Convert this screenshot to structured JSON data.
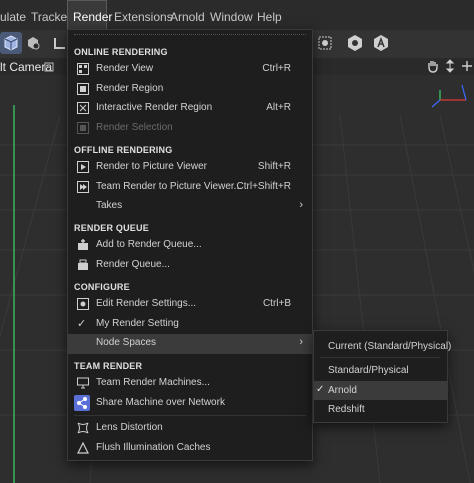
{
  "menubar": {
    "items": [
      "ulate",
      "Tracker",
      "Render",
      "Extensions",
      "Arnold",
      "Window",
      "Help"
    ]
  },
  "viewport": {
    "camera_label": "lt Camera"
  },
  "menu": {
    "sections": {
      "online": "ONLINE RENDERING",
      "offline": "OFFLINE RENDERING",
      "queue": "RENDER QUEUE",
      "configure": "CONFIGURE",
      "team": "TEAM RENDER"
    },
    "items": {
      "render_view": {
        "label": "Render View",
        "shortcut": "Ctrl+R"
      },
      "render_region": {
        "label": "Render Region"
      },
      "interactive_render_region": {
        "label": "Interactive Render Region",
        "shortcut": "Alt+R"
      },
      "render_selection": {
        "label": "Render Selection"
      },
      "render_to_picture_viewer": {
        "label": "Render to Picture Viewer",
        "shortcut": "Shift+R"
      },
      "team_render_to_picture_viewer": {
        "label": "Team Render to Picture Viewer...",
        "shortcut": "Ctrl+Shift+R"
      },
      "takes": {
        "label": "Takes"
      },
      "add_to_render_queue": {
        "label": "Add to Render Queue..."
      },
      "render_queue": {
        "label": "Render Queue..."
      },
      "edit_render_settings": {
        "label": "Edit Render Settings...",
        "shortcut": "Ctrl+B"
      },
      "my_render_setting": {
        "label": "My Render Setting"
      },
      "node_spaces": {
        "label": "Node Spaces"
      },
      "team_render_machines": {
        "label": "Team Render Machines..."
      },
      "share_machine": {
        "label": "Share Machine over Network"
      },
      "lens_distortion": {
        "label": "Lens Distortion"
      },
      "flush_illumination": {
        "label": "Flush Illumination Caches"
      }
    }
  },
  "submenu": {
    "items": [
      {
        "label": "Current (Standard/Physical)"
      },
      {
        "label": "Standard/Physical"
      },
      {
        "label": "Arnold",
        "checked": true
      },
      {
        "label": "Redshift"
      }
    ]
  },
  "colors": {
    "menu_bg": "#1e1e1e",
    "highlight": "#3b3b3b",
    "share_icon": "#5a6fd8",
    "axis_green": "#3bd46a",
    "axis_blue": "#3a6cff",
    "axis_red": "#e23a3a",
    "toolbar_selected": "#4a5a78"
  }
}
